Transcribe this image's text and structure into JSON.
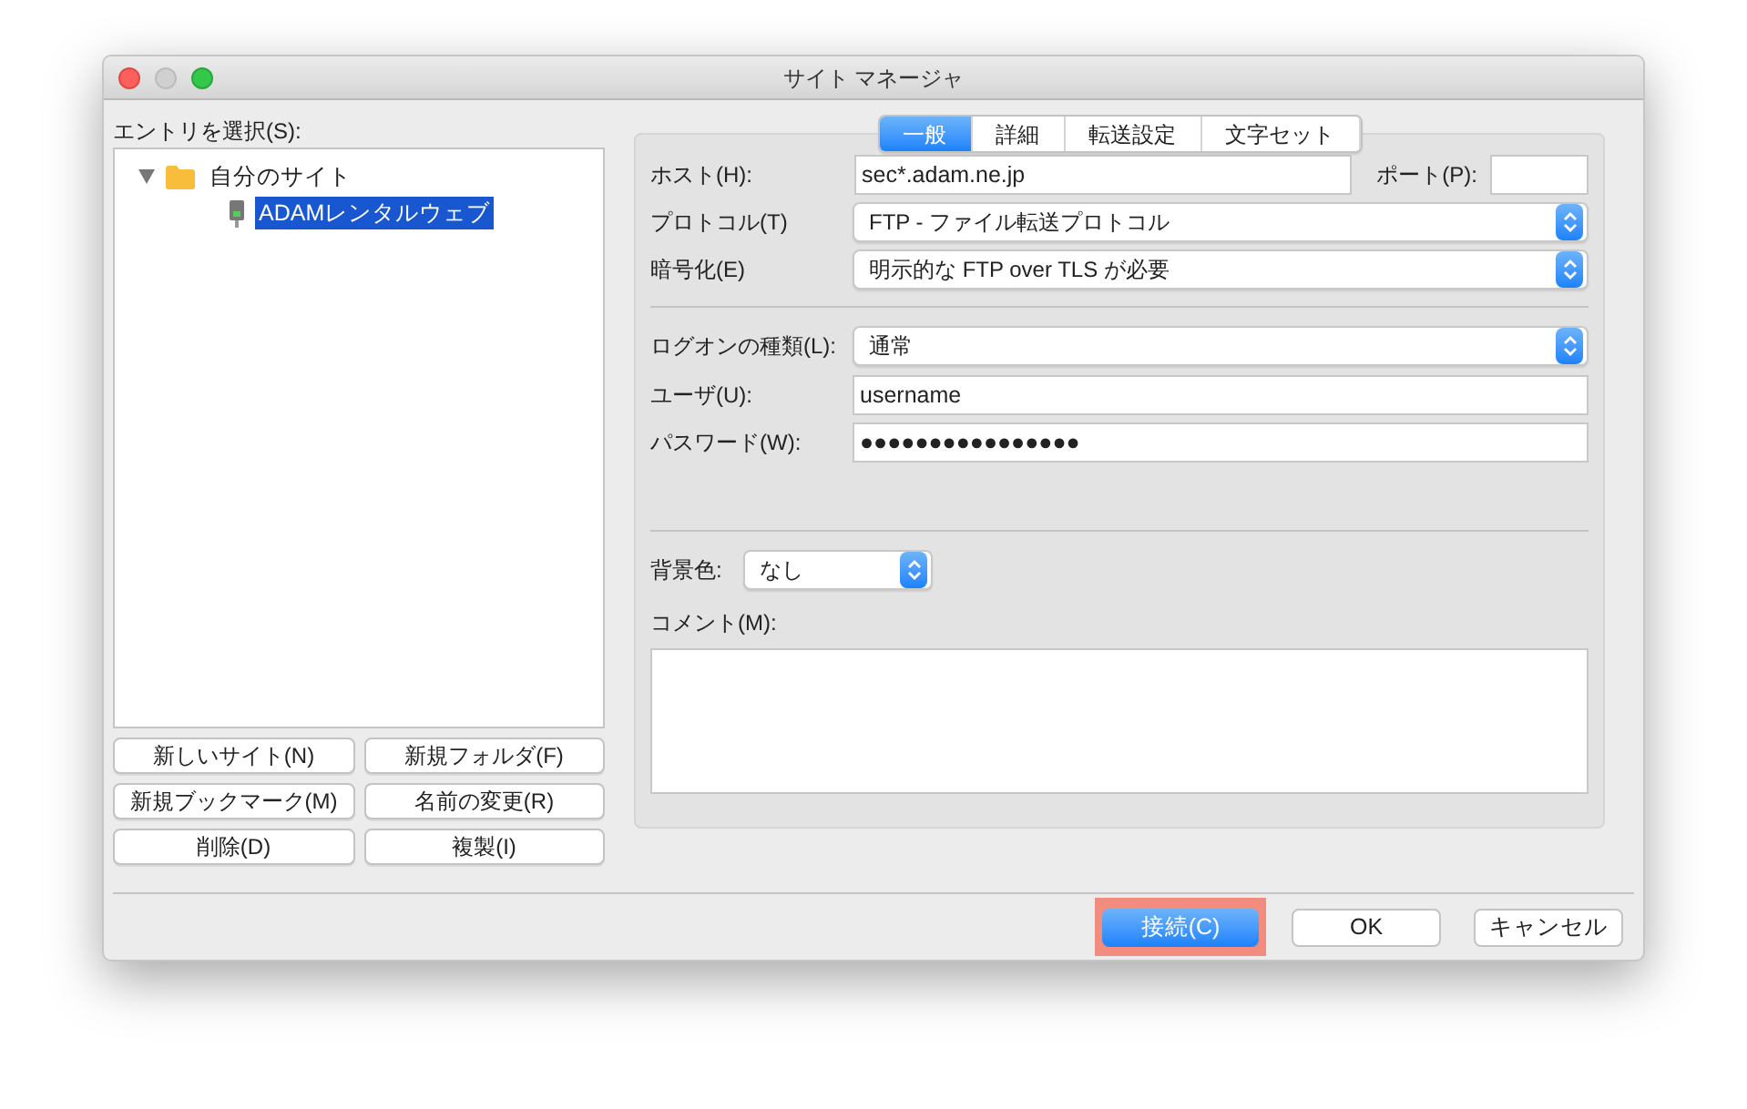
{
  "window": {
    "title": "サイト マネージャ"
  },
  "entry_label": "エントリを選択(S):",
  "tree": [
    {
      "label": "自分のサイト",
      "kind": "folder",
      "expanded": true,
      "selected": false,
      "children": [
        {
          "label": "ADAMレンタルウェブ",
          "kind": "site",
          "selected": true
        }
      ]
    }
  ],
  "left_buttons": [
    {
      "label": "新しいサイト(N)"
    },
    {
      "label": "新規フォルダ(F)"
    },
    {
      "label": "新規ブックマーク(M)"
    },
    {
      "label": "名前の変更(R)"
    },
    {
      "label": "削除(D)"
    },
    {
      "label": "複製(I)"
    }
  ],
  "tabs": [
    {
      "label": "一般",
      "selected": true
    },
    {
      "label": "詳細",
      "selected": false
    },
    {
      "label": "転送設定",
      "selected": false
    },
    {
      "label": "文字セット",
      "selected": false
    }
  ],
  "host": {
    "label": "ホスト(H):",
    "value": "sec*.adam.ne.jp"
  },
  "port": {
    "label": "ポート(P):"
  },
  "protocol": {
    "label": "プロトコル(T)",
    "value": "FTP - ファイル転送プロトコル"
  },
  "encryption": {
    "label": "暗号化(E)",
    "value": "明示的な FTP over TLS が必要"
  },
  "logon_type": {
    "label": "ログオンの種類(L):",
    "value": "通常"
  },
  "user": {
    "label": "ユーザ(U):",
    "value": "username"
  },
  "password": {
    "label": "パスワード(W):",
    "value": "●●●●●●●●●●●●●●●●"
  },
  "background_color": {
    "label": "背景色:",
    "value": "なし"
  },
  "comment": {
    "label": "コメント(M):"
  },
  "footer_buttons": [
    {
      "label": "接続(C)",
      "kind": "primary",
      "highlighted": true
    },
    {
      "label": "OK",
      "kind": "default",
      "highlighted": false
    },
    {
      "label": "キャンセル",
      "kind": "default",
      "highlighted": false
    }
  ]
}
